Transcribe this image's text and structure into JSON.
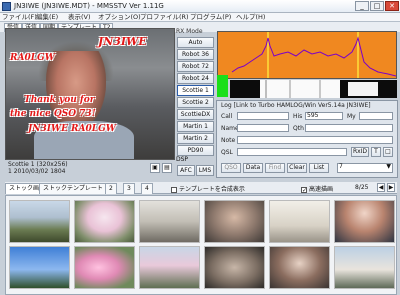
{
  "window": {
    "title": "JN3IWE (JN3IWE.MDT) - MMSSTV Ver 1.11G",
    "minimize": "_",
    "maximize": "□",
    "close": "✕"
  },
  "menu": [
    "ファイル(F)",
    "編集(E)",
    "表示(V)",
    "オプション(O)",
    "プロファイル(R)",
    "プログラム(P)",
    "ヘルプ(H)"
  ],
  "tabs": [
    "受信",
    "送信",
    "同期",
    "テンプレート",
    "T2"
  ],
  "rx_overlay": {
    "callsign1": "JN3IWE",
    "callsign2": "RA0LGW",
    "line1": "Thank you for",
    "line2": "the nice QSO 73!",
    "line3": "JN3IWE RA0LGW"
  },
  "status": {
    "line1": "Scottie 1 (320x256)",
    "line2": "1 2010/03/02 1804"
  },
  "rx_mode": {
    "label": "RX Mode",
    "buttons": [
      "Auto",
      "Robot 36",
      "Robot 72",
      "Robot 24",
      "Scottie 1",
      "Scottie 2",
      "ScottieDX",
      "Martin 1",
      "Martin 2",
      "PD90"
    ],
    "active": "Scottie 1"
  },
  "dsp": {
    "label": "DSP",
    "afc": "AFC",
    "lms": "LMS"
  },
  "log": {
    "title": "Log [Link to Turbo HAMLOG/Win Ver5.14a JN3IWE]",
    "call_label": "Call",
    "his_label": "His",
    "his_value": "595",
    "my_label": "My",
    "name_label": "Name",
    "qth_label": "Qth",
    "note_label": "Note",
    "qsl_label": "QSL",
    "rxid": "RxID",
    "buttons": [
      "QSO",
      "Data",
      "Find",
      "Clear",
      "List"
    ],
    "list_value": "7"
  },
  "bottom_tabs": [
    "ストック画像",
    "ストックテンプレート 1",
    "2",
    "3",
    "4"
  ],
  "template_check_label": "テンプレートを合成表示",
  "quality_label": "高速描画",
  "page_counter": "8/25",
  "thumbnail_names": [
    "thumb-1-tree",
    "thumb-2-tree",
    "thumb-3-person",
    "thumb-4-person",
    "thumb-5-room",
    "thumb-6-person",
    "thumb-7-sky",
    "thumb-8-flowers",
    "thumb-9-temple",
    "thumb-10-kimono",
    "thumb-11-person",
    "thumb-12-temple"
  ]
}
